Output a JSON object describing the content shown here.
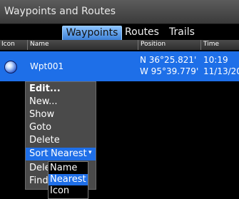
{
  "window": {
    "title": "Waypoints and Routes"
  },
  "tabs": [
    {
      "label": "Waypoints",
      "active": true
    },
    {
      "label": "Routes",
      "active": false
    },
    {
      "label": "Trails",
      "active": false
    }
  ],
  "columns": [
    "Icon",
    "Name",
    "Position",
    "Time"
  ],
  "waypoints": [
    {
      "icon": "waypoint-dot-icon",
      "name": "Wpt001",
      "lat": "N  36°25.821'",
      "lon": "W  95°39.779'",
      "time": "10:19",
      "date": "11/13/20"
    }
  ],
  "menu": {
    "items": [
      "Edit...",
      "New...",
      "Show",
      "Goto",
      "Delete"
    ],
    "sort_label": "Sort",
    "sort_value": "Nearest",
    "after_sort": [
      "Dele",
      "Find."
    ]
  },
  "sort_options": [
    "Name",
    "Nearest",
    "Icon"
  ],
  "colors": {
    "accent": "#1f6fe8",
    "title_bar": "#4a4a4a",
    "background": "#000000"
  }
}
